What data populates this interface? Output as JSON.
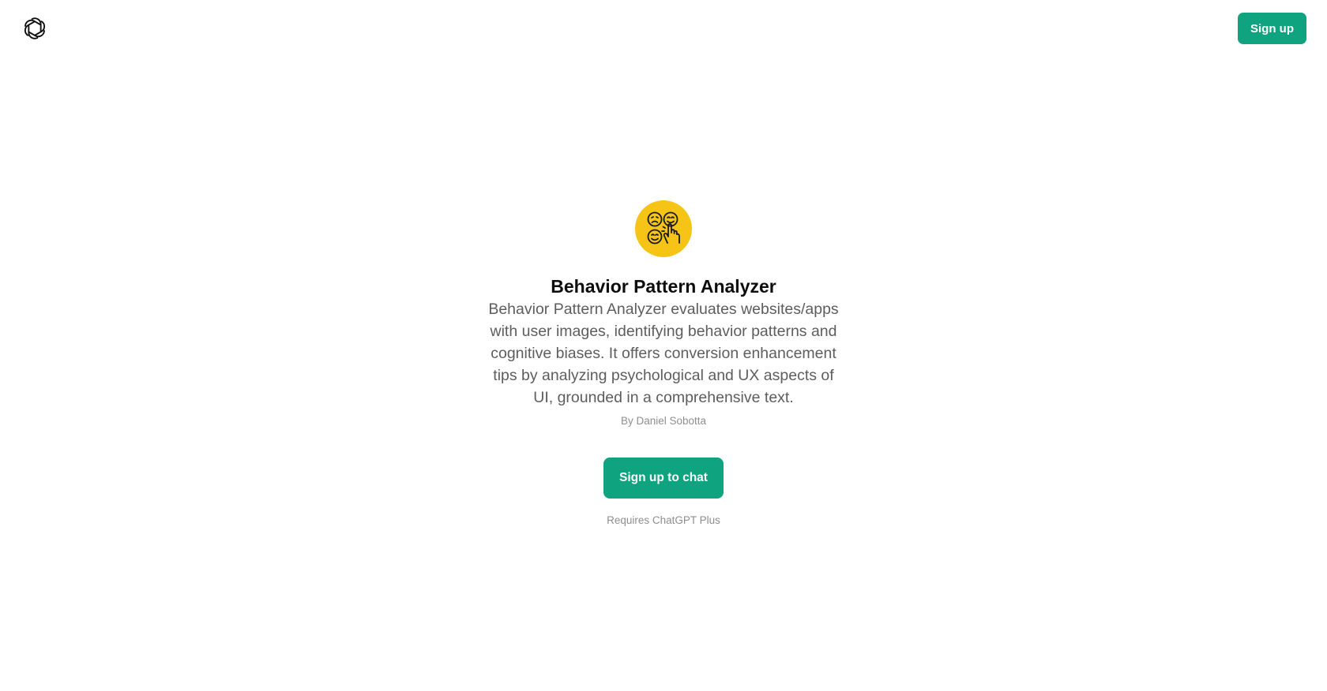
{
  "header": {
    "logo_icon": "openai-logo-icon",
    "signup_label": "Sign up"
  },
  "gpt": {
    "avatar_icon": "faces-with-pointing-hand-icon",
    "name": "Behavior Pattern Analyzer",
    "description": "Behavior Pattern Analyzer evaluates websites/apps with user images, identifying behavior patterns and cognitive biases. It offers conversion enhancement tips by analyzing psychological and UX aspects of UI, grounded in a comprehensive text.",
    "author": "By Daniel Sobotta"
  },
  "cta": {
    "label": "Sign up to chat",
    "requirement": "Requires ChatGPT Plus"
  },
  "colors": {
    "accent": "#10a37f",
    "avatar_bg": "#f6c416",
    "text_primary": "#0d0d0d",
    "text_secondary": "#5d5d5d",
    "text_muted": "#8e8e8e"
  }
}
